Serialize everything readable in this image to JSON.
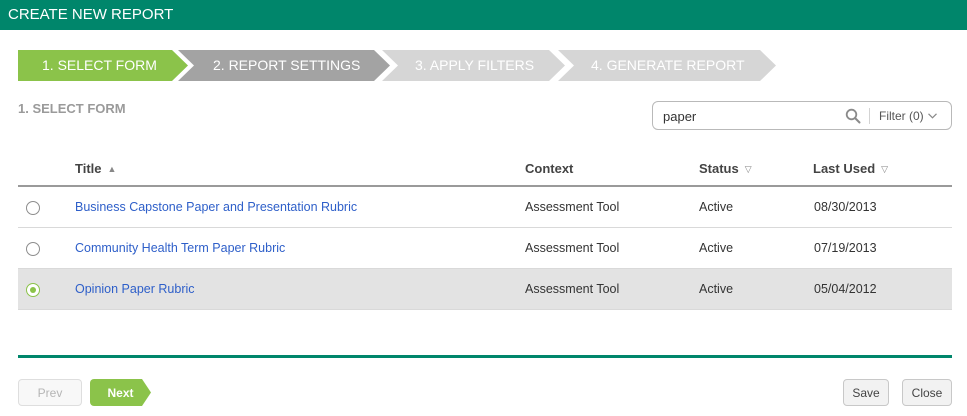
{
  "header": {
    "title": "CREATE NEW REPORT"
  },
  "wizard": {
    "steps": [
      {
        "label": "1. SELECT FORM"
      },
      {
        "label": "2. REPORT SETTINGS"
      },
      {
        "label": "3. APPLY FILTERS"
      },
      {
        "label": "4. GENERATE REPORT"
      }
    ]
  },
  "section": {
    "title": "1. SELECT FORM"
  },
  "search": {
    "value": "paper",
    "filter_label": "Filter (0)"
  },
  "table": {
    "columns": {
      "title": "Title",
      "context": "Context",
      "status": "Status",
      "last_used": "Last Used"
    },
    "rows": [
      {
        "title": "Business Capstone Paper and Presentation Rubric",
        "context": "Assessment Tool",
        "status": "Active",
        "last_used": "08/30/2013"
      },
      {
        "title": "Community Health Term Paper Rubric",
        "context": "Assessment Tool",
        "status": "Active",
        "last_used": "07/19/2013"
      },
      {
        "title": "Opinion Paper Rubric",
        "context": "Assessment Tool",
        "status": "Active",
        "last_used": "05/04/2012"
      }
    ]
  },
  "footer": {
    "prev_label": "Prev",
    "next_label": "Next",
    "save_label": "Save",
    "close_label": "Close"
  },
  "colors": {
    "brand": "#00866b",
    "accent": "#8bc34a",
    "link": "#2e5fc9"
  }
}
